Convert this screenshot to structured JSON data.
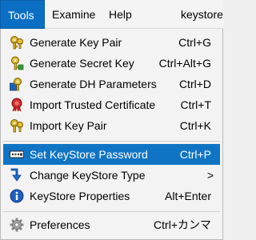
{
  "menubar": {
    "items": [
      {
        "label": "Tools"
      },
      {
        "label": "Examine"
      },
      {
        "label": "Help"
      },
      {
        "label": "keystore"
      }
    ]
  },
  "menu": {
    "items": [
      {
        "label": "Generate Key Pair",
        "shortcut": "Ctrl+G",
        "icon": "key-pair-icon"
      },
      {
        "label": "Generate Secret Key",
        "shortcut": "Ctrl+Alt+G",
        "icon": "secret-key-icon"
      },
      {
        "label": "Generate DH Parameters",
        "shortcut": "Ctrl+D",
        "icon": "dh-parameters-icon"
      },
      {
        "label": "Import Trusted Certificate",
        "shortcut": "Ctrl+T",
        "icon": "trusted-certificate-icon"
      },
      {
        "label": "Import Key Pair",
        "shortcut": "Ctrl+K",
        "icon": "import-key-pair-icon"
      },
      {
        "label": "Set KeyStore Password",
        "shortcut": "Ctrl+P",
        "icon": "password-icon"
      },
      {
        "label": "Change KeyStore Type",
        "shortcut": ">",
        "icon": "keystore-type-icon"
      },
      {
        "label": "KeyStore Properties",
        "shortcut": "Alt+Enter",
        "icon": "info-icon"
      },
      {
        "label": "Preferences",
        "shortcut": "Ctrl+カンマ",
        "icon": "gear-icon"
      }
    ]
  },
  "colors": {
    "selection": "#0f74c4",
    "menu_background": "#f3f3f3",
    "active_menu": "#0a6fc2"
  }
}
